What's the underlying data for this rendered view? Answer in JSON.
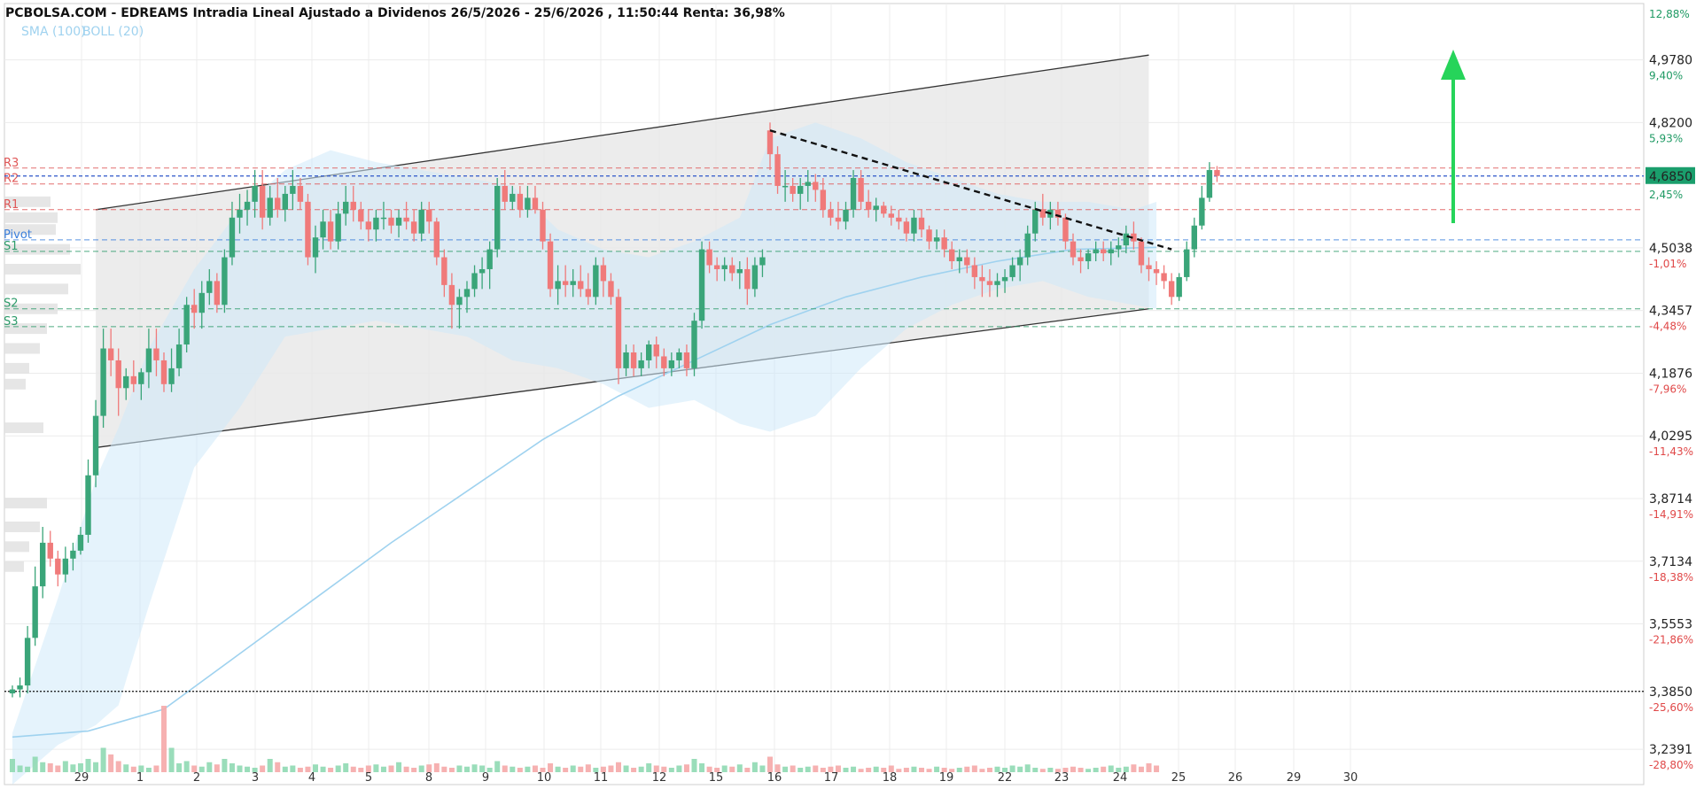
{
  "title": "PCBOLSA.COM - EDREAMS Intradia Lineal Ajustado a Dividenos 26/5/2026 - 25/6/2026 , 11:50:44 Renta: 36,98%",
  "indicators": [
    "SMA (100)",
    "BOLL (20)"
  ],
  "colors": {
    "up": "#3aa579",
    "down": "#f07a7a",
    "sma": "#9fd2ef",
    "boll_fill": "#cfe9f9",
    "channel_fill": "#e9e9e9",
    "resistance": "#e05757",
    "support": "#2e9c6b",
    "pivot": "#3b7fdc",
    "last_price_bg": "#1a9e6c",
    "arrow": "#26d45a"
  },
  "chart_data": {
    "type": "candlestick",
    "ylim": [
      3.15,
      5.12
    ],
    "y_ticks": [
      {
        "value": 4.978,
        "label": "4,9780",
        "pct": "9,40%"
      },
      {
        "value": 4.82,
        "label": "4,8200",
        "pct": "5,93%"
      },
      {
        "value": 4.5038,
        "label": "4,5038",
        "pct": "-1,01%"
      },
      {
        "value": 4.3457,
        "label": "4,3457",
        "pct": "-4,48%"
      },
      {
        "value": 4.1876,
        "label": "4,1876",
        "pct": "-7,96%"
      },
      {
        "value": 4.0295,
        "label": "4,0295",
        "pct": "-11,43%"
      },
      {
        "value": 3.8714,
        "label": "3,8714",
        "pct": "-14,91%"
      },
      {
        "value": 3.7134,
        "label": "3,7134",
        "pct": "-18,38%"
      },
      {
        "value": 3.5553,
        "label": "3,5553",
        "pct": "-21,86%"
      },
      {
        "value": 3.385,
        "label": "3,3850",
        "pct": "-25,60%"
      },
      {
        "value": 3.2391,
        "label": "3,2391",
        "pct": "-28,80%"
      }
    ],
    "top_pct": "12,88%",
    "last_price": {
      "value": 4.685,
      "label": "4,6850",
      "pct": "2,45%"
    },
    "x_labels": [
      "29",
      "1",
      "2",
      "3",
      "4",
      "5",
      "8",
      "9",
      "10",
      "11",
      "12",
      "15",
      "16",
      "17",
      "18",
      "19",
      "22",
      "23",
      "24",
      "25",
      "26",
      "29",
      "30"
    ],
    "pivot_levels": [
      {
        "name": "R3",
        "value": 4.705,
        "kind": "resistance"
      },
      {
        "name": "R2",
        "value": 4.665,
        "kind": "resistance"
      },
      {
        "name": "R1",
        "value": 4.6,
        "kind": "resistance"
      },
      {
        "name": "Pivot",
        "value": 4.524,
        "kind": "pivot"
      },
      {
        "name": "S1",
        "value": 4.495,
        "kind": "support"
      },
      {
        "name": "S2",
        "value": 4.35,
        "kind": "support"
      },
      {
        "name": "S3",
        "value": 4.305,
        "kind": "support"
      }
    ],
    "support_level": 3.385,
    "last_price_line": 4.685,
    "candles": [
      [
        3.38,
        3.4,
        3.37,
        3.39
      ],
      [
        3.39,
        3.42,
        3.37,
        3.4
      ],
      [
        3.4,
        3.55,
        3.38,
        3.52
      ],
      [
        3.52,
        3.7,
        3.5,
        3.65
      ],
      [
        3.65,
        3.8,
        3.62,
        3.76
      ],
      [
        3.76,
        3.79,
        3.7,
        3.72
      ],
      [
        3.72,
        3.74,
        3.65,
        3.68
      ],
      [
        3.68,
        3.75,
        3.66,
        3.72
      ],
      [
        3.72,
        3.76,
        3.69,
        3.74
      ],
      [
        3.74,
        3.8,
        3.73,
        3.78
      ],
      [
        3.78,
        3.97,
        3.76,
        3.93
      ],
      [
        3.93,
        4.12,
        3.9,
        4.08
      ],
      [
        4.08,
        4.3,
        4.05,
        4.25
      ],
      [
        4.25,
        4.3,
        4.18,
        4.22
      ],
      [
        4.22,
        4.25,
        4.08,
        4.15
      ],
      [
        4.15,
        4.2,
        4.12,
        4.18
      ],
      [
        4.18,
        4.22,
        4.14,
        4.16
      ],
      [
        4.16,
        4.2,
        4.12,
        4.19
      ],
      [
        4.19,
        4.3,
        4.15,
        4.25
      ],
      [
        4.25,
        4.3,
        4.18,
        4.22
      ],
      [
        4.22,
        4.24,
        4.14,
        4.16
      ],
      [
        4.16,
        4.25,
        4.14,
        4.2
      ],
      [
        4.2,
        4.3,
        4.18,
        4.26
      ],
      [
        4.26,
        4.38,
        4.24,
        4.36
      ],
      [
        4.36,
        4.4,
        4.3,
        4.34
      ],
      [
        4.34,
        4.42,
        4.3,
        4.39
      ],
      [
        4.39,
        4.45,
        4.36,
        4.42
      ],
      [
        4.42,
        4.44,
        4.34,
        4.36
      ],
      [
        4.36,
        4.5,
        4.34,
        4.48
      ],
      [
        4.48,
        4.62,
        4.46,
        4.58
      ],
      [
        4.58,
        4.64,
        4.54,
        4.6
      ],
      [
        4.6,
        4.65,
        4.56,
        4.62
      ],
      [
        4.62,
        4.7,
        4.58,
        4.66
      ],
      [
        4.66,
        4.7,
        4.55,
        4.58
      ],
      [
        4.58,
        4.66,
        4.56,
        4.63
      ],
      [
        4.63,
        4.68,
        4.58,
        4.6
      ],
      [
        4.6,
        4.66,
        4.57,
        4.64
      ],
      [
        4.64,
        4.7,
        4.6,
        4.66
      ],
      [
        4.66,
        4.68,
        4.6,
        4.62
      ],
      [
        4.62,
        4.64,
        4.46,
        4.48
      ],
      [
        4.48,
        4.56,
        4.44,
        4.53
      ],
      [
        4.53,
        4.6,
        4.5,
        4.57
      ],
      [
        4.57,
        4.6,
        4.5,
        4.52
      ],
      [
        4.52,
        4.62,
        4.5,
        4.59
      ],
      [
        4.59,
        4.66,
        4.56,
        4.62
      ],
      [
        4.62,
        4.66,
        4.57,
        4.6
      ],
      [
        4.6,
        4.62,
        4.55,
        4.57
      ],
      [
        4.57,
        4.6,
        4.52,
        4.55
      ],
      [
        4.55,
        4.6,
        4.52,
        4.58
      ],
      [
        4.58,
        4.62,
        4.55,
        4.58
      ],
      [
        4.58,
        4.6,
        4.54,
        4.56
      ],
      [
        4.56,
        4.6,
        4.53,
        4.58
      ],
      [
        4.58,
        4.62,
        4.55,
        4.57
      ],
      [
        4.57,
        4.6,
        4.52,
        4.54
      ],
      [
        4.54,
        4.62,
        4.52,
        4.6
      ],
      [
        4.6,
        4.62,
        4.54,
        4.57
      ],
      [
        4.57,
        4.58,
        4.46,
        4.48
      ],
      [
        4.48,
        4.5,
        4.38,
        4.41
      ],
      [
        4.41,
        4.44,
        4.3,
        4.36
      ],
      [
        4.36,
        4.4,
        4.3,
        4.38
      ],
      [
        4.38,
        4.42,
        4.34,
        4.4
      ],
      [
        4.4,
        4.46,
        4.38,
        4.44
      ],
      [
        4.44,
        4.48,
        4.4,
        4.45
      ],
      [
        4.45,
        4.52,
        4.4,
        4.5
      ],
      [
        4.5,
        4.68,
        4.48,
        4.66
      ],
      [
        4.66,
        4.7,
        4.6,
        4.62
      ],
      [
        4.62,
        4.66,
        4.6,
        4.64
      ],
      [
        4.64,
        4.66,
        4.58,
        4.6
      ],
      [
        4.6,
        4.66,
        4.58,
        4.63
      ],
      [
        4.63,
        4.66,
        4.59,
        4.6
      ],
      [
        4.6,
        4.62,
        4.5,
        4.52
      ],
      [
        4.52,
        4.54,
        4.38,
        4.4
      ],
      [
        4.4,
        4.46,
        4.36,
        4.42
      ],
      [
        4.42,
        4.46,
        4.38,
        4.41
      ],
      [
        4.41,
        4.45,
        4.38,
        4.42
      ],
      [
        4.42,
        4.46,
        4.38,
        4.4
      ],
      [
        4.4,
        4.44,
        4.36,
        4.38
      ],
      [
        4.38,
        4.48,
        4.36,
        4.46
      ],
      [
        4.46,
        4.48,
        4.38,
        4.42
      ],
      [
        4.42,
        4.44,
        4.36,
        4.38
      ],
      [
        4.38,
        4.4,
        4.16,
        4.2
      ],
      [
        4.2,
        4.26,
        4.18,
        4.24
      ],
      [
        4.24,
        4.26,
        4.18,
        4.2
      ],
      [
        4.2,
        4.24,
        4.18,
        4.22
      ],
      [
        4.22,
        4.27,
        4.2,
        4.26
      ],
      [
        4.26,
        4.28,
        4.2,
        4.23
      ],
      [
        4.23,
        4.25,
        4.18,
        4.2
      ],
      [
        4.2,
        4.24,
        4.18,
        4.22
      ],
      [
        4.22,
        4.25,
        4.2,
        4.24
      ],
      [
        4.24,
        4.26,
        4.18,
        4.2
      ],
      [
        4.2,
        4.34,
        4.18,
        4.32
      ],
      [
        4.32,
        4.52,
        4.3,
        4.5
      ],
      [
        4.5,
        4.52,
        4.44,
        4.46
      ],
      [
        4.46,
        4.48,
        4.42,
        4.45
      ],
      [
        4.45,
        4.48,
        4.42,
        4.46
      ],
      [
        4.46,
        4.48,
        4.42,
        4.44
      ],
      [
        4.44,
        4.47,
        4.4,
        4.45
      ],
      [
        4.45,
        4.48,
        4.36,
        4.4
      ],
      [
        4.4,
        4.48,
        4.38,
        4.46
      ],
      [
        4.46,
        4.5,
        4.43,
        4.48
      ],
      [
        4.8,
        4.82,
        4.7,
        4.74
      ],
      [
        4.74,
        4.76,
        4.64,
        4.66
      ],
      [
        4.66,
        4.7,
        4.62,
        4.66
      ],
      [
        4.66,
        4.68,
        4.62,
        4.64
      ],
      [
        4.64,
        4.68,
        4.6,
        4.66
      ],
      [
        4.66,
        4.7,
        4.62,
        4.67
      ],
      [
        4.67,
        4.69,
        4.62,
        4.65
      ],
      [
        4.65,
        4.68,
        4.58,
        4.6
      ],
      [
        4.6,
        4.62,
        4.56,
        4.58
      ],
      [
        4.58,
        4.62,
        4.55,
        4.57
      ],
      [
        4.57,
        4.62,
        4.55,
        4.6
      ],
      [
        4.6,
        4.7,
        4.58,
        4.68
      ],
      [
        4.68,
        4.7,
        4.6,
        4.62
      ],
      [
        4.62,
        4.65,
        4.58,
        4.6
      ],
      [
        4.6,
        4.63,
        4.57,
        4.61
      ],
      [
        4.61,
        4.62,
        4.58,
        4.59
      ],
      [
        4.59,
        4.61,
        4.56,
        4.58
      ],
      [
        4.58,
        4.6,
        4.55,
        4.57
      ],
      [
        4.57,
        4.58,
        4.52,
        4.54
      ],
      [
        4.54,
        4.6,
        4.52,
        4.58
      ],
      [
        4.58,
        4.6,
        4.53,
        4.55
      ],
      [
        4.55,
        4.56,
        4.5,
        4.52
      ],
      [
        4.52,
        4.55,
        4.5,
        4.53
      ],
      [
        4.53,
        4.55,
        4.48,
        4.5
      ],
      [
        4.5,
        4.52,
        4.45,
        4.47
      ],
      [
        4.47,
        4.5,
        4.44,
        4.48
      ],
      [
        4.48,
        4.5,
        4.44,
        4.46
      ],
      [
        4.46,
        4.48,
        4.4,
        4.43
      ],
      [
        4.43,
        4.46,
        4.38,
        4.42
      ],
      [
        4.42,
        4.45,
        4.38,
        4.41
      ],
      [
        4.41,
        4.44,
        4.38,
        4.42
      ],
      [
        4.42,
        4.45,
        4.39,
        4.43
      ],
      [
        4.43,
        4.48,
        4.42,
        4.46
      ],
      [
        4.46,
        4.5,
        4.42,
        4.48
      ],
      [
        4.48,
        4.56,
        4.46,
        4.54
      ],
      [
        4.54,
        4.62,
        4.52,
        4.6
      ],
      [
        4.6,
        4.64,
        4.56,
        4.58
      ],
      [
        4.58,
        4.62,
        4.55,
        4.6
      ],
      [
        4.6,
        4.62,
        4.56,
        4.58
      ],
      [
        4.58,
        4.59,
        4.5,
        4.52
      ],
      [
        4.52,
        4.54,
        4.46,
        4.48
      ],
      [
        4.48,
        4.5,
        4.44,
        4.47
      ],
      [
        4.47,
        4.5,
        4.45,
        4.49
      ],
      [
        4.49,
        4.52,
        4.47,
        4.5
      ],
      [
        4.5,
        4.52,
        4.47,
        4.49
      ],
      [
        4.49,
        4.52,
        4.46,
        4.5
      ],
      [
        4.5,
        4.53,
        4.48,
        4.51
      ],
      [
        4.51,
        4.56,
        4.49,
        4.54
      ],
      [
        4.54,
        4.57,
        4.5,
        4.52
      ],
      [
        4.52,
        4.53,
        4.44,
        4.46
      ],
      [
        4.46,
        4.48,
        4.42,
        4.45
      ],
      [
        4.45,
        4.47,
        4.41,
        4.44
      ],
      [
        4.44,
        4.46,
        4.4,
        4.42
      ],
      [
        4.42,
        4.44,
        4.36,
        4.38
      ],
      [
        4.38,
        4.44,
        4.37,
        4.43
      ],
      [
        4.43,
        4.52,
        4.42,
        4.5
      ],
      [
        4.5,
        4.58,
        4.48,
        4.56
      ],
      [
        4.56,
        4.66,
        4.55,
        4.63
      ],
      [
        4.63,
        4.72,
        4.62,
        4.7
      ],
      [
        4.7,
        4.71,
        4.67,
        4.685
      ]
    ],
    "volumes": [
      12,
      6,
      5,
      14,
      9,
      8,
      6,
      10,
      7,
      8,
      12,
      9,
      22,
      16,
      10,
      7,
      5,
      6,
      4,
      6,
      60,
      22,
      8,
      10,
      6,
      5,
      9,
      7,
      12,
      8,
      6,
      5,
      4,
      6,
      12,
      9,
      5,
      6,
      4,
      5,
      7,
      5,
      4,
      6,
      8,
      5,
      4,
      6,
      7,
      5,
      6,
      9,
      5,
      4,
      6,
      7,
      8,
      5,
      4,
      6,
      5,
      7,
      6,
      4,
      10,
      6,
      5,
      4,
      5,
      6,
      4,
      8,
      5,
      4,
      6,
      5,
      7,
      4,
      5,
      6,
      9,
      6,
      4,
      5,
      8,
      6,
      5,
      4,
      6,
      7,
      12,
      8,
      5,
      4,
      6,
      5,
      7,
      4,
      9,
      6,
      14,
      7,
      5,
      6,
      4,
      5,
      6,
      4,
      5,
      6,
      4,
      5,
      3,
      4,
      5,
      4,
      6,
      3,
      4,
      5,
      4,
      3,
      5,
      4,
      3,
      4,
      5,
      6,
      3,
      4,
      5,
      4,
      6,
      5,
      7,
      4,
      3,
      4,
      3,
      4,
      5,
      4,
      3,
      4,
      5,
      6,
      4,
      5,
      7,
      5,
      8,
      6
    ],
    "sma100": [
      [
        0,
        3.27
      ],
      [
        10,
        3.285
      ],
      [
        20,
        3.34
      ],
      [
        30,
        3.48
      ],
      [
        40,
        3.62
      ],
      [
        50,
        3.76
      ],
      [
        60,
        3.89
      ],
      [
        70,
        4.02
      ],
      [
        80,
        4.13
      ],
      [
        90,
        4.22
      ],
      [
        100,
        4.31
      ],
      [
        110,
        4.38
      ],
      [
        120,
        4.43
      ],
      [
        130,
        4.47
      ],
      [
        140,
        4.5
      ],
      [
        151,
        4.505
      ]
    ],
    "bollinger_upper": [
      [
        0,
        3.28
      ],
      [
        6,
        3.62
      ],
      [
        11,
        3.92
      ],
      [
        14,
        4.05
      ],
      [
        18,
        4.25
      ],
      [
        24,
        4.45
      ],
      [
        30,
        4.6
      ],
      [
        36,
        4.7
      ],
      [
        42,
        4.75
      ],
      [
        48,
        4.72
      ],
      [
        54,
        4.7
      ],
      [
        60,
        4.68
      ],
      [
        66,
        4.66
      ],
      [
        72,
        4.55
      ],
      [
        78,
        4.5
      ],
      [
        84,
        4.48
      ],
      [
        90,
        4.52
      ],
      [
        96,
        4.58
      ],
      [
        100,
        4.78
      ],
      [
        106,
        4.82
      ],
      [
        112,
        4.78
      ],
      [
        118,
        4.72
      ],
      [
        124,
        4.68
      ],
      [
        130,
        4.64
      ],
      [
        136,
        4.62
      ],
      [
        142,
        4.62
      ],
      [
        148,
        4.6
      ],
      [
        151,
        4.62
      ]
    ],
    "bollinger_lower": [
      [
        0,
        3.15
      ],
      [
        6,
        3.25
      ],
      [
        11,
        3.3
      ],
      [
        14,
        3.35
      ],
      [
        18,
        3.6
      ],
      [
        24,
        3.95
      ],
      [
        30,
        4.1
      ],
      [
        36,
        4.28
      ],
      [
        42,
        4.3
      ],
      [
        48,
        4.32
      ],
      [
        54,
        4.3
      ],
      [
        60,
        4.28
      ],
      [
        66,
        4.22
      ],
      [
        72,
        4.2
      ],
      [
        78,
        4.16
      ],
      [
        84,
        4.1
      ],
      [
        90,
        4.12
      ],
      [
        96,
        4.06
      ],
      [
        100,
        4.04
      ],
      [
        106,
        4.08
      ],
      [
        112,
        4.2
      ],
      [
        118,
        4.3
      ],
      [
        124,
        4.36
      ],
      [
        130,
        4.4
      ],
      [
        136,
        4.42
      ],
      [
        142,
        4.38
      ],
      [
        148,
        4.36
      ],
      [
        151,
        4.35
      ]
    ],
    "channel": {
      "upper": [
        [
          11,
          4.6
        ],
        [
          150,
          4.99
        ]
      ],
      "lower": [
        [
          11,
          4.0
        ],
        [
          150,
          4.35
        ]
      ]
    },
    "trendline_dashed": [
      [
        100,
        4.8
      ],
      [
        153,
        4.5
      ]
    ]
  }
}
